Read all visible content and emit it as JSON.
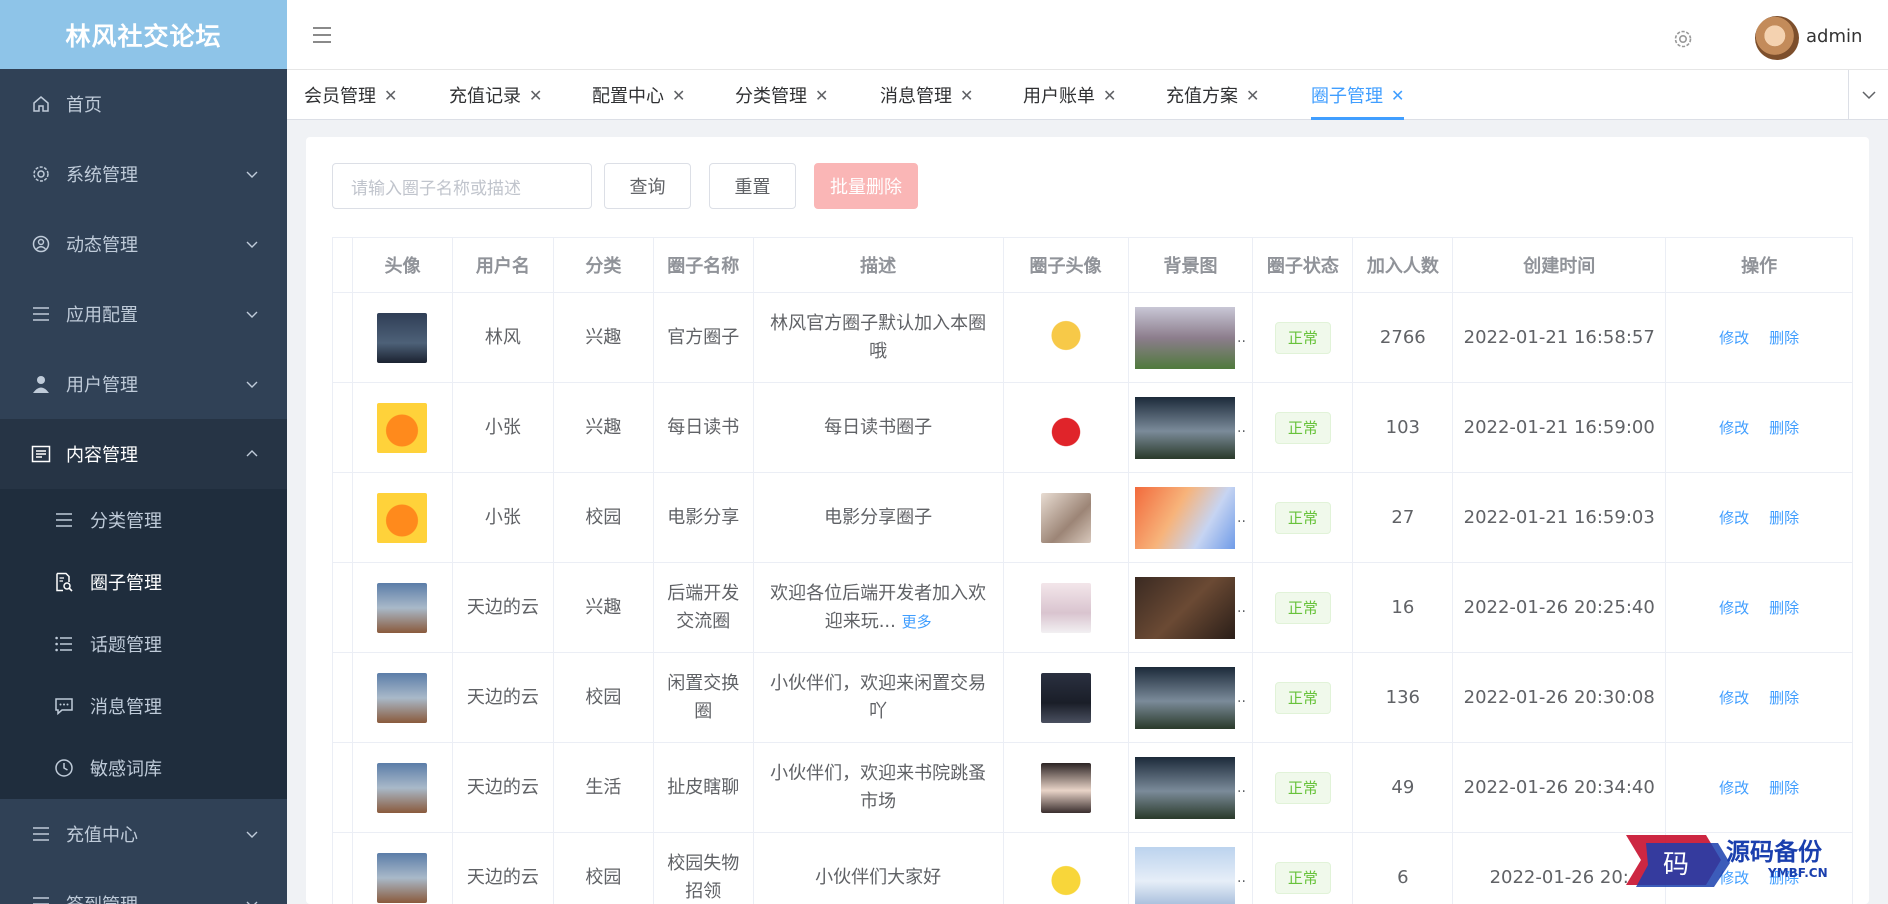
{
  "app": {
    "title": "林风社交论坛"
  },
  "sidebar": {
    "items": [
      {
        "label": "首页",
        "icon": "home-icon"
      },
      {
        "label": "系统管理",
        "icon": "settings-icon"
      },
      {
        "label": "动态管理",
        "icon": "moments-icon"
      },
      {
        "label": "应用配置",
        "icon": "list-icon"
      },
      {
        "label": "用户管理",
        "icon": "user-icon"
      },
      {
        "label": "内容管理",
        "icon": "content-icon"
      },
      {
        "label": "充值中心",
        "icon": "list-icon"
      },
      {
        "label": "签到管理",
        "icon": "list-icon"
      }
    ],
    "subitems": [
      {
        "label": "分类管理",
        "icon": "list-icon"
      },
      {
        "label": "圈子管理",
        "icon": "doc-search-icon"
      },
      {
        "label": "话题管理",
        "icon": "list-check-icon"
      },
      {
        "label": "消息管理",
        "icon": "chat-icon"
      },
      {
        "label": "敏感词库",
        "icon": "clock-icon"
      }
    ]
  },
  "navbar": {
    "user": "admin"
  },
  "tags": [
    "会员管理",
    "充值记录",
    "配置中心",
    "分类管理",
    "消息管理",
    "用户账单",
    "充值方案",
    "圈子管理"
  ],
  "toolbar": {
    "search_placeholder": "请输入圈子名称或描述",
    "query_label": "查询",
    "reset_label": "重置",
    "batch_delete_label": "批量删除"
  },
  "table": {
    "headers": [
      "头像",
      "用户名",
      "分类",
      "圈子名称",
      "描述",
      "圈子头像",
      "背景图",
      "圈子状态",
      "加入人数",
      "创建时间",
      "操作"
    ],
    "edit_label": "修改",
    "delete_label": "删除",
    "more_label": "更多",
    "ellipsis": "..",
    "rows": [
      {
        "user": "林风",
        "category": "兴趣",
        "name": "官方圈子",
        "desc": "林风官方圈子默认加入本圈哦",
        "status": "正常",
        "members": "2766",
        "created": "2022-01-21 16:58:57"
      },
      {
        "user": "小张",
        "category": "兴趣",
        "name": "每日读书",
        "desc": "每日读书圈子",
        "status": "正常",
        "members": "103",
        "created": "2022-01-21 16:59:00"
      },
      {
        "user": "小张",
        "category": "校园",
        "name": "电影分享",
        "desc": "电影分享圈子",
        "status": "正常",
        "members": "27",
        "created": "2022-01-21 16:59:03"
      },
      {
        "user": "天边的云",
        "category": "兴趣",
        "name": "后端开发交流圈",
        "desc": "欢迎各位后端开发者加入欢迎来玩...",
        "status": "正常",
        "members": "16",
        "created": "2022-01-26 20:25:40"
      },
      {
        "user": "天边的云",
        "category": "校园",
        "name": "闲置交换圈",
        "desc": "小伙伴们，欢迎来闲置交易吖",
        "status": "正常",
        "members": "136",
        "created": "2022-01-26 20:30:08"
      },
      {
        "user": "天边的云",
        "category": "生活",
        "name": "扯皮瞎聊",
        "desc": "小伙伴们，欢迎来书院跳蚤市场",
        "status": "正常",
        "members": "49",
        "created": "2022-01-26 20:34:40"
      },
      {
        "user": "天边的云",
        "category": "校园",
        "name": "校园失物招领",
        "desc": "小伙伴们大家好",
        "status": "正常",
        "members": "6",
        "created": "2022-01-26 20:"
      }
    ]
  },
  "watermark": {
    "text": "源码备份",
    "sub": "YMBF.CN",
    "glyph": "码"
  },
  "colors": {
    "sidebar": "#304156",
    "logo": "#8ec4e8",
    "accent": "#409eff",
    "success": "#67c23a",
    "danger_light": "#fab6b6"
  }
}
